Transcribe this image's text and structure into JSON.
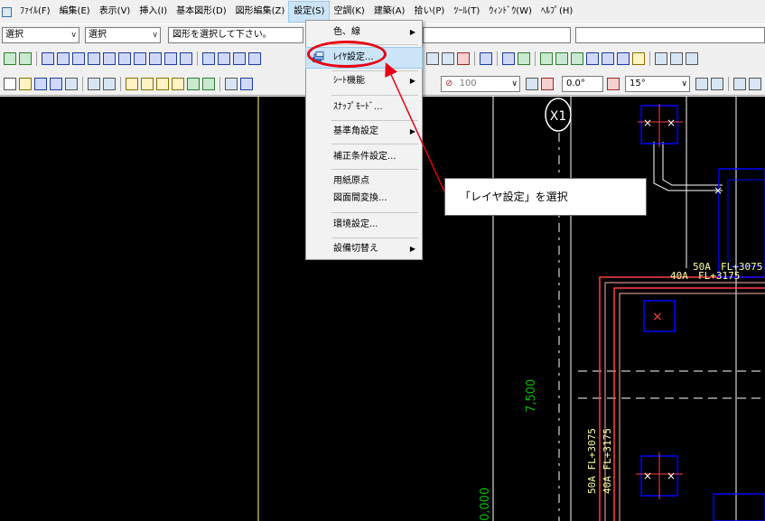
{
  "menubar": {
    "items": [
      "ﾌｧｲﾙ(F)",
      "編集(E)",
      "表示(V)",
      "挿入(I)",
      "基本図形(D)",
      "図形編集(Z)",
      "設定(S)",
      "空調(K)",
      "建築(A)",
      "拾い(P)",
      "ﾂｰﾙ(T)",
      "ｳｨﾝﾄﾞｳ(W)",
      "ﾍﾙﾌﾟ(H)"
    ]
  },
  "toolbar": {
    "mode_combo": "選択",
    "sub_combo": "選択",
    "status_text": "図形を選択して下さい。",
    "opacity_value": "100",
    "angle_value": "0.0°",
    "snap_angle_value": "15°"
  },
  "dropdown": {
    "items": [
      {
        "label": "色、線",
        "submenu": true
      },
      {
        "label": "ﾚｲﾔ設定...",
        "submenu": false
      },
      {
        "label": "ｼｰﾄ機能",
        "submenu": true
      },
      {
        "label": "ｽﾅｯﾌﾟﾓｰﾄﾞ...",
        "submenu": false
      },
      {
        "label": "基準角設定",
        "submenu": true
      },
      {
        "label": "補正条件設定...",
        "submenu": false
      },
      {
        "label": "用紙原点",
        "submenu": false
      },
      {
        "label": "図面間変換...",
        "submenu": false
      },
      {
        "label": "環境設定...",
        "submenu": false
      },
      {
        "label": "設備切替え",
        "submenu": true
      }
    ]
  },
  "annotation": {
    "callout_text": "「レイヤ設定」を選択",
    "highlight_color": "#e60012"
  },
  "canvas": {
    "grid_label": "X1",
    "dim_7500": "7,500",
    "dim_0000": "0,000",
    "pipe_label_1": "50A",
    "pipe_label_1b": "FL+3075",
    "pipe_label_2": "40A",
    "pipe_label_2b": "FL+3175",
    "pipe_label_v1": "50A FL+3075",
    "pipe_label_v2": "40A FL+3175",
    "colors": {
      "background": "#000000",
      "duct": "#0000ff",
      "pipe": "#ff4040",
      "pipe_light": "#ffb0b0",
      "dim_text": "#00c000",
      "label_text": "#ffffa0",
      "gridline": "#ffffff",
      "guide": "#ffff80"
    }
  }
}
